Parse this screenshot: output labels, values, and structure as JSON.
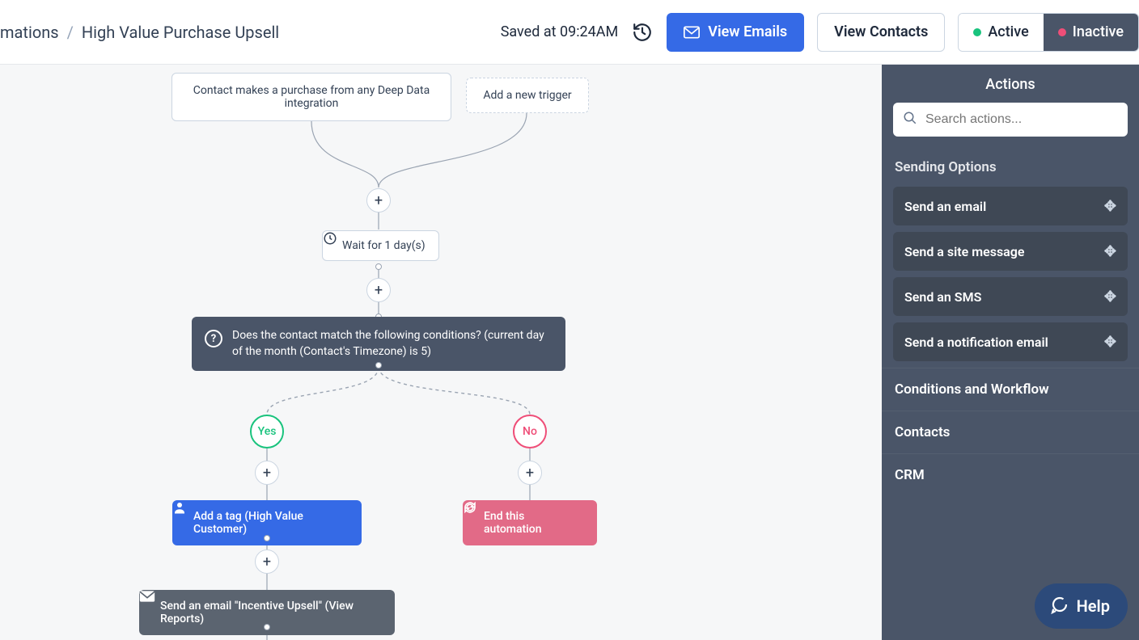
{
  "header": {
    "breadcrumb_parent": "mations",
    "breadcrumb_sep": "/",
    "breadcrumb_current": "High Value Purchase Upsell",
    "saved_text": "Saved at 09:24AM",
    "view_emails": "View Emails",
    "view_contacts": "View Contacts",
    "active": "Active",
    "inactive": "Inactive"
  },
  "canvas": {
    "trigger1": "Contact makes a purchase from any Deep Data integration",
    "trigger_add": "Add a new trigger",
    "wait_label": "Wait for 1 day(s)",
    "condition_text": "Does the contact match the following conditions? (current day of the month (Contact's Timezone) is 5)",
    "yes": "Yes",
    "no": "No",
    "tag_action": "Add a tag (High Value Customer)",
    "end_action": "End this automation",
    "email_action": "Send an email \"Incentive Upsell\" (View Reports)"
  },
  "sidebar": {
    "title": "Actions",
    "search_placeholder": "Search actions...",
    "sending_options": "Sending Options",
    "items": [
      {
        "label": "Send an email"
      },
      {
        "label": "Send a site message"
      },
      {
        "label": "Send an SMS"
      },
      {
        "label": "Send a notification email"
      }
    ],
    "conditions": "Conditions and Workflow",
    "contacts": "Contacts",
    "crm": "CRM"
  },
  "help": {
    "label": "Help"
  }
}
